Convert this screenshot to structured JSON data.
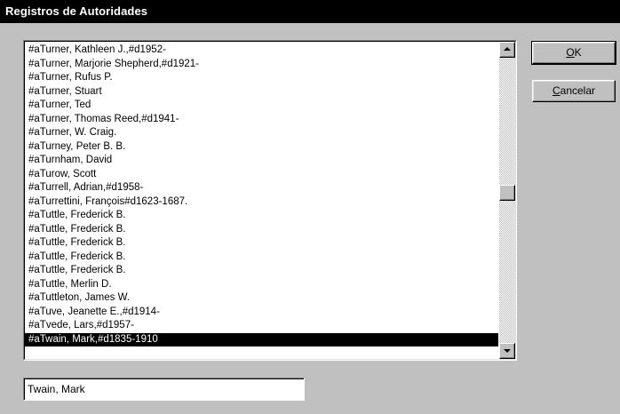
{
  "dialog": {
    "title": "Registros de Autoridades"
  },
  "list": {
    "items": [
      "#aTurner, Kathleen J.,#d1952-",
      "#aTurner, Marjorie Shepherd,#d1921-",
      "#aTurner, Rufus P.",
      "#aTurner, Stuart",
      "#aTurner, Ted",
      "#aTurner, Thomas Reed,#d1941-",
      "#aTurner, W. Craig.",
      "#aTurney, Peter B. B.",
      "#aTurnham, David",
      "#aTurow, Scott",
      "#aTurrell, Adrian,#d1958-",
      "#aTurrettini, François#d1623-1687.",
      "#aTuttle, Frederick B.",
      "#aTuttle, Frederick B.",
      "#aTuttle, Frederick B.",
      "#aTuttle, Frederick B.",
      "#aTuttle, Frederick B.",
      "#aTuttle, Merlin D.",
      "#aTuttleton, James W.",
      "#aTuve, Jeanette E.,#d1914-",
      "#aTvede, Lars,#d1957-",
      "#aTwain, Mark,#d1835-1910"
    ],
    "selected_index": 21,
    "scroll_position": 0.47
  },
  "buttons": {
    "ok": {
      "accel": "O",
      "rest": "K"
    },
    "cancel": {
      "accel": "C",
      "rest": "ancelar"
    }
  },
  "search": {
    "value": "Twain, Mark"
  }
}
